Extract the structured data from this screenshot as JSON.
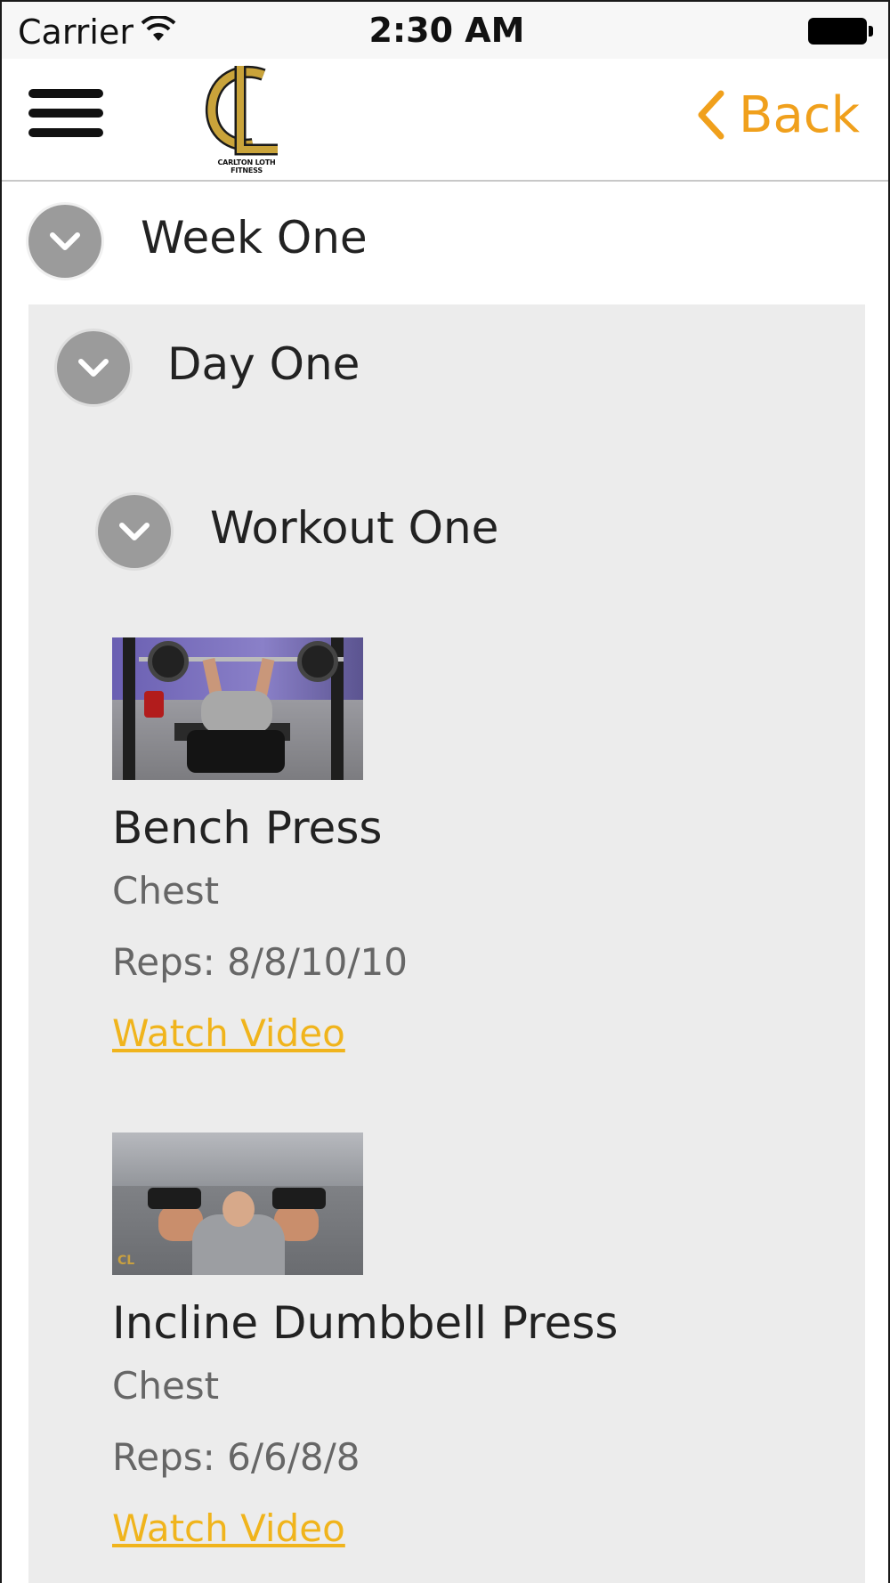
{
  "status_bar": {
    "carrier": "Carrier",
    "time": "2:30 AM",
    "wifi_icon": "wifi-icon",
    "battery_icon": "battery-full-icon"
  },
  "nav": {
    "menu_icon": "hamburger-menu-icon",
    "logo_text": "CARLTON LOTH FITNESS",
    "back_label": "Back",
    "accent_color": "#f0a01c"
  },
  "program": {
    "week_title": "Week One",
    "day_title": "Day One",
    "workout_title": "Workout One",
    "expand_icon": "chevron-down-icon"
  },
  "exercises": [
    {
      "name": "Bench Press",
      "muscle": "Chest",
      "reps": "Reps: 8/8/10/10",
      "link": "Watch Video"
    },
    {
      "name": "Incline Dumbbell Press",
      "muscle": "Chest",
      "reps": "Reps: 6/6/8/8",
      "link": "Watch Video"
    }
  ],
  "colors": {
    "link": "#f0b41c",
    "panel_bg": "#ececec",
    "circle_button": "#9b9b9b"
  }
}
